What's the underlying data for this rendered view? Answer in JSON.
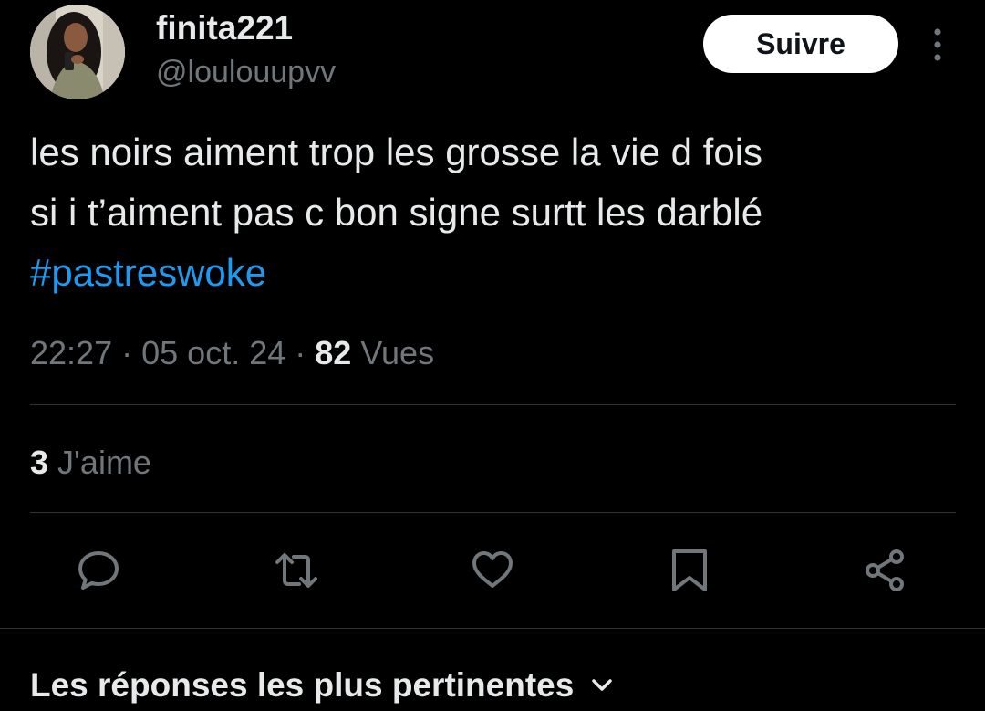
{
  "author": {
    "display_name": "finita221",
    "handle": "@loulouupvv",
    "avatar_icon": "profile-photo"
  },
  "follow_label": "Suivre",
  "more_icon": "vertical-ellipsis-icon",
  "tweet": {
    "lines": [
      "les noirs aiment trop les grosse la vie d fois",
      "si i t’aiment pas c bon signe surtt les darblé"
    ],
    "hashtag": "#pastreswoke"
  },
  "meta": {
    "time": "22:27",
    "separator": "·",
    "date": "05 oct. 24",
    "views_count": "82",
    "views_label": "Vues"
  },
  "likes": {
    "count": "3",
    "label": "J'aime"
  },
  "actions": [
    "reply-icon",
    "retweet-icon",
    "like-icon",
    "bookmark-icon",
    "share-icon"
  ],
  "replies_header": "Les réponses les plus pertinentes",
  "colors": {
    "background": "#000000",
    "text": "#e7e9ea",
    "muted": "#71767b",
    "link": "#1d9bf0",
    "divider": "#2f3336"
  }
}
